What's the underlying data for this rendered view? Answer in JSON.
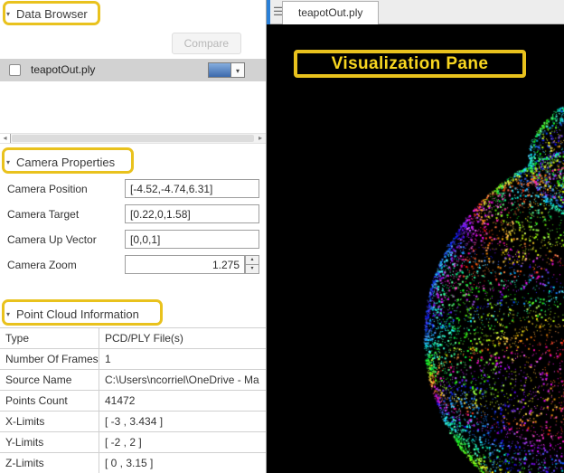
{
  "data_browser": {
    "title": "Data Browser",
    "compare_button_label": "Compare",
    "items": [
      {
        "label": "teapotOut.ply",
        "checked": false,
        "swatch_color": "#4a7ebb"
      }
    ]
  },
  "camera_properties": {
    "title": "Camera Properties",
    "fields": [
      {
        "label": "Camera Position",
        "value": "[-4.52,-4.74,6.31]"
      },
      {
        "label": "Camera Target",
        "value": "[0.22,0,1.58]"
      },
      {
        "label": "Camera Up Vector",
        "value": "[0,0,1]"
      },
      {
        "label": "Camera Zoom",
        "value": "1.275"
      }
    ]
  },
  "point_cloud_information": {
    "title": "Point Cloud Information",
    "rows": [
      {
        "label": "Type",
        "value": "PCD/PLY File(s)"
      },
      {
        "label": "Number Of Frames",
        "value": "1"
      },
      {
        "label": "Source Name",
        "value": "C:\\Users\\ncorriel\\OneDrive - Ma"
      },
      {
        "label": "Points Count",
        "value": "41472"
      },
      {
        "label": "X-Limits",
        "value": "[ -3 , 3.434 ]"
      },
      {
        "label": "Y-Limits",
        "value": "[ -2 , 2 ]"
      },
      {
        "label": "Z-Limits",
        "value": "[ 0 , 3.15 ]"
      }
    ]
  },
  "visualization": {
    "tab_label": "teapotOut.ply",
    "pane_annotation": "Visualization Pane"
  },
  "annotation": {
    "highlight_color": "#e9c21d"
  }
}
